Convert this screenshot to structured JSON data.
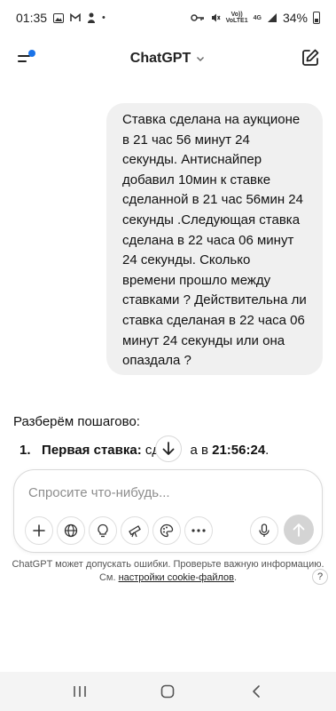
{
  "status_bar": {
    "time": "01:35",
    "network_top": "VoLTE1",
    "signal_label": "4G",
    "battery": "34%"
  },
  "header": {
    "title": "ChatGPT"
  },
  "conversation": {
    "user_message": "Ставка сделана на аукционе\nв 21 час 56 минут 24\nсекунды. Антиснайпер\nдобавил 10мин к ставке\nсделанной в 21 час 56мин 24\nсекунды .Следующая ставка\nсделана в 22 часа 06 минут\n24 секунды. Сколько\nвремени прошло между\nставками ? Действительна ли\nставка сделаная в 22 часа 06\nминут 24 секунды или она\nопаздала ?",
    "assistant_intro": "Разберём пошагово:",
    "step_number": "1.",
    "step_bold": "Первая ставка:",
    "step_text_before": " сде",
    "step_text_after": "а в ",
    "step_time": "21:56:24",
    "step_end": "."
  },
  "composer": {
    "placeholder": "Спросите что-нибудь..."
  },
  "disclaimer": {
    "line1": "ChatGPT может допускать ошибки. Проверьте важную информацию.",
    "line2_prefix": "См. ",
    "link": "настройки cookie-файлов",
    "line2_suffix": "."
  },
  "help": {
    "label": "?"
  },
  "colors": {
    "accent_dot": "#1a73e8",
    "bubble_bg": "#f0f0f0",
    "send_bg": "#d4d4d4"
  }
}
